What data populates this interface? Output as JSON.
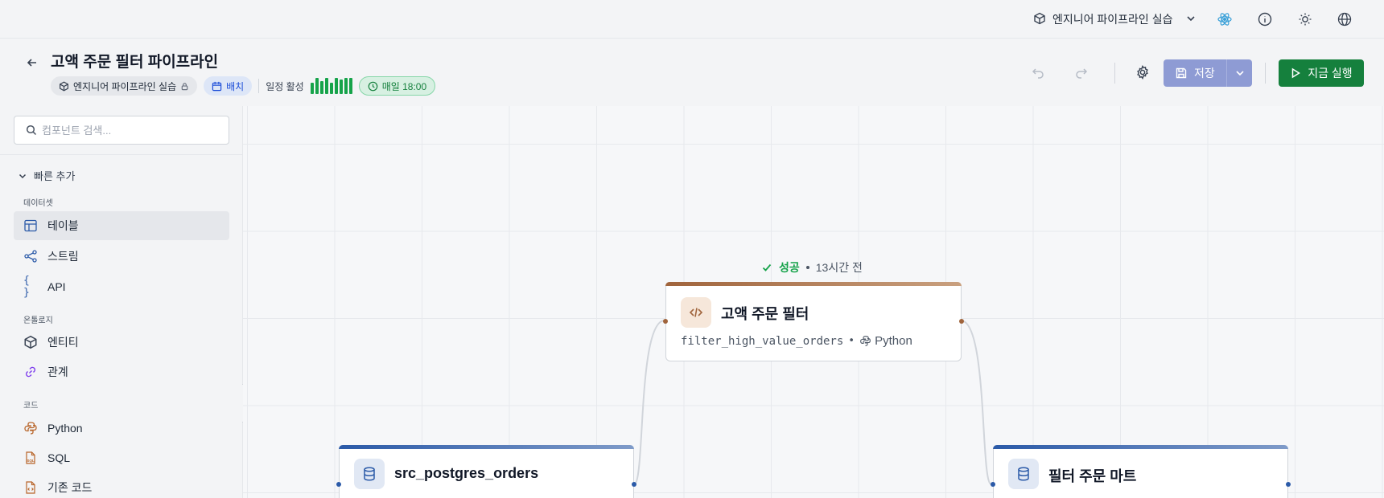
{
  "topbar": {
    "workspace_name": "엔지니어 파이프라인 실습"
  },
  "header": {
    "title": "고액 주문 필터 파이프라인",
    "workspace_chip": "엔지니어 파이프라인 실습",
    "type_chip": "배치",
    "schedule_activity_label": "일정 활성",
    "schedule_chip": "매일 18:00",
    "save_label": "저장",
    "run_label": "지금 실행"
  },
  "sidebar": {
    "search_placeholder": "컴포넌트 검색...",
    "quick_add_label": "빠른 추가",
    "groups": [
      {
        "label": "데이터셋",
        "items": [
          {
            "label": "테이블"
          },
          {
            "label": "스트림"
          },
          {
            "label": "API"
          }
        ]
      },
      {
        "label": "온톨로지",
        "items": [
          {
            "label": "엔티티"
          },
          {
            "label": "관계"
          }
        ]
      },
      {
        "label": "코드",
        "items": [
          {
            "label": "Python"
          },
          {
            "label": "SQL"
          },
          {
            "label": "기존 코드"
          }
        ]
      }
    ]
  },
  "canvas": {
    "run_status": {
      "state": "성공",
      "ago": "13시간 전"
    },
    "nodes": {
      "transform": {
        "title": "고액 주문 필터",
        "function": "filter_high_value_orders",
        "language": "Python",
        "accent": "#a0643c"
      },
      "source": {
        "title": "src_postgres_orders",
        "accent": "#2b5aa8"
      },
      "sink": {
        "title": "필터 주문 마트",
        "accent": "#2b5aa8"
      }
    }
  },
  "colors": {
    "primary_green": "#15803d",
    "save_disabled": "#8e9bd4",
    "success": "#16a34a",
    "batch_blue": "#1d4ed8"
  }
}
